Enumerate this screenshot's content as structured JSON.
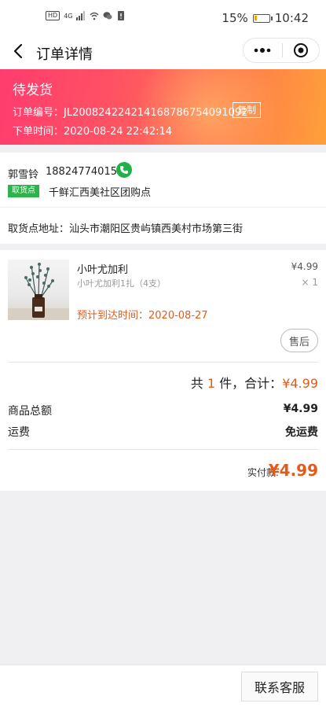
{
  "status_bar": {
    "network_label": "HD",
    "signal_label": "4G",
    "battery_percent": "15%",
    "battery_level": 0.15,
    "time": "10:42"
  },
  "nav": {
    "title": "订单详情"
  },
  "order": {
    "status": "待发货",
    "order_no_line": "订单编号：JL20082422421416878675409​1092",
    "copy_label": "复制",
    "order_time_line": "下单时间：2020-08-24 22:42:14"
  },
  "buyer": {
    "name": "郭雪铃",
    "phone": "18824774015",
    "pickup_tag": "取货点",
    "pickup_name": "千鲜汇西美社区团购点"
  },
  "address": {
    "text": "取货点地址：汕头市潮阳区贵屿镇西美村市场第三街"
  },
  "goods": {
    "title": "小叶尤加利",
    "price": "¥4.99",
    "spec": "小叶尤加利1扎（4支）",
    "qty": "× 1",
    "arrival": "预计到达时间：2020-08-27",
    "after_sale": "售后"
  },
  "summary": {
    "total_prefix": "共 ",
    "total_count": "1",
    "total_middle": " 件，合计：",
    "total_amount": "¥4.99",
    "goods_total_label": "商品总额",
    "goods_total_value": "¥4.99",
    "shipping_label": "运费",
    "shipping_value": "免运费",
    "paid_label": "实付款:",
    "paid_value": "¥4.99"
  },
  "footer": {
    "contact_label": "联系客服"
  },
  "colors": {
    "accent": "#e25a1c",
    "banner_start": "#ff3c6e",
    "banner_end": "#ffa03a",
    "pickup_green": "#2cb34a",
    "phone_green": "#22b04b"
  }
}
